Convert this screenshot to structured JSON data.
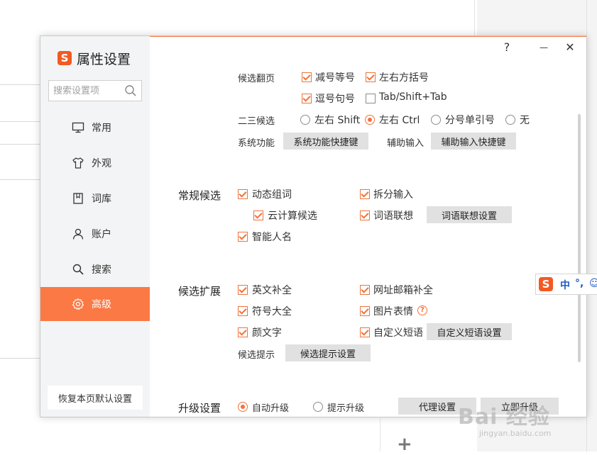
{
  "dialog": {
    "title": "属性设置",
    "logo_letter": "S",
    "controls": {
      "help": "?",
      "minimize": "—",
      "close": "✕"
    }
  },
  "sidebar": {
    "search_placeholder": "搜索设置项",
    "items": [
      {
        "label": "常用",
        "icon": "monitor-icon"
      },
      {
        "label": "外观",
        "icon": "shirt-icon"
      },
      {
        "label": "词库",
        "icon": "book-icon"
      },
      {
        "label": "账户",
        "icon": "user-icon"
      },
      {
        "label": "搜索",
        "icon": "search-icon"
      },
      {
        "label": "高级",
        "icon": "gear-icon",
        "active": true
      }
    ],
    "reset_label": "恢复本页默认设置"
  },
  "candidate_page": {
    "label": "候选翻页",
    "options": [
      {
        "label": "减号等号",
        "checked": true
      },
      {
        "label": "左右方括号",
        "checked": true
      },
      {
        "label": "逗号句号",
        "checked": true
      },
      {
        "label": "Tab/Shift+Tab",
        "checked": false
      }
    ]
  },
  "second_third": {
    "label": "二三候选",
    "options": [
      {
        "label": "左右 Shift",
        "selected": false
      },
      {
        "label": "左右 Ctrl",
        "selected": true
      },
      {
        "label": "分号单引号",
        "selected": false
      },
      {
        "label": "无",
        "selected": false
      }
    ]
  },
  "system_function": {
    "label": "系统功能",
    "button": "系统功能快捷键"
  },
  "aux_input": {
    "label": "辅助输入",
    "button": "辅助输入快捷键"
  },
  "regular_candidates": {
    "title": "常规候选",
    "options": [
      {
        "label": "动态组词",
        "checked": true
      },
      {
        "label": "拆分输入",
        "checked": true
      },
      {
        "label": "云计算候选",
        "checked": true
      },
      {
        "label": "词语联想",
        "checked": true
      },
      {
        "label": "智能人名",
        "checked": true
      }
    ],
    "assoc_button": "词语联想设置"
  },
  "candidate_expand": {
    "title": "候选扩展",
    "options": [
      {
        "label": "英文补全",
        "checked": true
      },
      {
        "label": "网址邮箱补全",
        "checked": true
      },
      {
        "label": "符号大全",
        "checked": true
      },
      {
        "label": "图片表情",
        "checked": true
      },
      {
        "label": "颜文字",
        "checked": true
      },
      {
        "label": "自定义短语",
        "checked": true
      }
    ],
    "help_mark": "?",
    "phrase_button": "自定义短语设置",
    "hint_label": "候选提示",
    "hint_button": "候选提示设置"
  },
  "upgrade": {
    "title": "升级设置",
    "options": [
      {
        "label": "自动升级",
        "selected": true
      },
      {
        "label": "提示升级",
        "selected": false
      }
    ],
    "proxy_button": "代理设置",
    "upgrade_now_button": "立即升级"
  },
  "ime_toolbar": {
    "logo_letter": "S",
    "mode": "中",
    "punct": "°,",
    "emoji": "☺"
  },
  "watermark": {
    "main": "Bai 经验",
    "sub": "jingyan.baidu.com"
  },
  "colors": {
    "accent": "#fb7945",
    "brand": "#f25a22"
  }
}
